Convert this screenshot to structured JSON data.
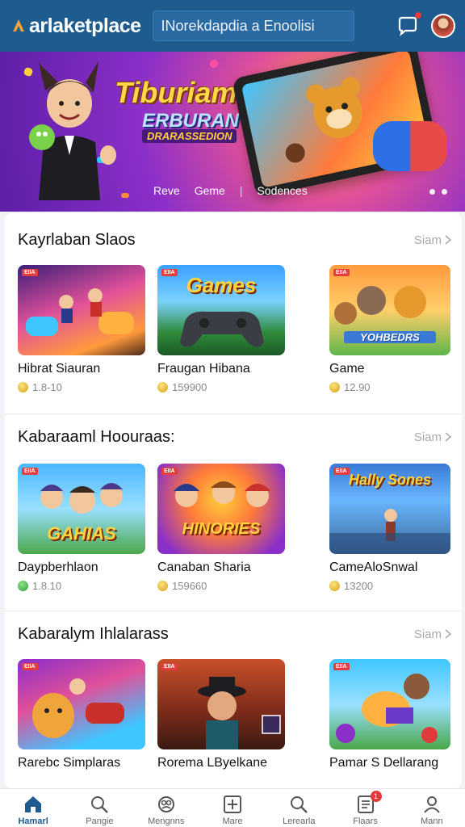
{
  "header": {
    "logo_text": "arlaketplace",
    "search_text": "INorekdapdia a Enoolisi"
  },
  "banner": {
    "title": "Tiburiam",
    "subtitle": "ERBURAN",
    "subtitle2": "DRARASSEDION",
    "tabs": [
      "Reve",
      "Geme",
      "|",
      "Sodences"
    ],
    "colors": {
      "title": "#ffd84a",
      "background": "#8b2fc9"
    }
  },
  "sections": [
    {
      "title": "Kayrlaban Slaos",
      "see_all": "Siam",
      "items": [
        {
          "name": "Hibrat Siauran",
          "price": "1.8-10",
          "coin": "gold",
          "tag": "EIIA",
          "art_text": ""
        },
        {
          "name": "Fraugan Hibana",
          "price": "159900",
          "coin": "gold",
          "tag": "EIIA",
          "art_text": "Games"
        },
        {
          "name": "Game",
          "price": "12.90",
          "coin": "gold",
          "tag": "EIIA",
          "art_text": "YOHBEDRS"
        }
      ]
    },
    {
      "title": "Kabaraaml Hoouraas:",
      "see_all": "Siam",
      "items": [
        {
          "name": "Daypberhlaon",
          "price": "1.8.10",
          "coin": "green",
          "tag": "EIIA",
          "art_text": "GAHIAS"
        },
        {
          "name": "Canaban Sharia",
          "price": "159660",
          "coin": "gold",
          "tag": "EIIA",
          "art_text": "HINORIES"
        },
        {
          "name": "CameAloSnwal",
          "price": "13200",
          "coin": "gold",
          "tag": "EIIA",
          "art_text": "Hally Sones"
        }
      ]
    },
    {
      "title": "Kabaralym Ihlalarass",
      "see_all": "Siam",
      "items": [
        {
          "name": "Rarebc Simplaras",
          "price": "",
          "coin": "gold",
          "tag": "EIIA",
          "art_text": ""
        },
        {
          "name": "Rorema LByelkane",
          "price": "",
          "coin": "gold",
          "tag": "EIIA",
          "art_text": ""
        },
        {
          "name": "Pamar S Dellarang",
          "price": "",
          "coin": "gold",
          "tag": "EIIA",
          "art_text": ""
        }
      ]
    }
  ],
  "bottom_nav": [
    {
      "label": "Hamarl",
      "icon": "home-icon",
      "active": true
    },
    {
      "label": "Pangie",
      "icon": "search-icon",
      "active": false
    },
    {
      "label": "Mengnns",
      "icon": "community-icon",
      "active": false
    },
    {
      "label": "Mare",
      "icon": "plus-box-icon",
      "active": false
    },
    {
      "label": "Lerearla",
      "icon": "search-icon",
      "active": false
    },
    {
      "label": "Flaars",
      "icon": "list-icon",
      "active": false,
      "badge": "1"
    },
    {
      "label": "Mann",
      "icon": "profile-icon",
      "active": false
    }
  ]
}
